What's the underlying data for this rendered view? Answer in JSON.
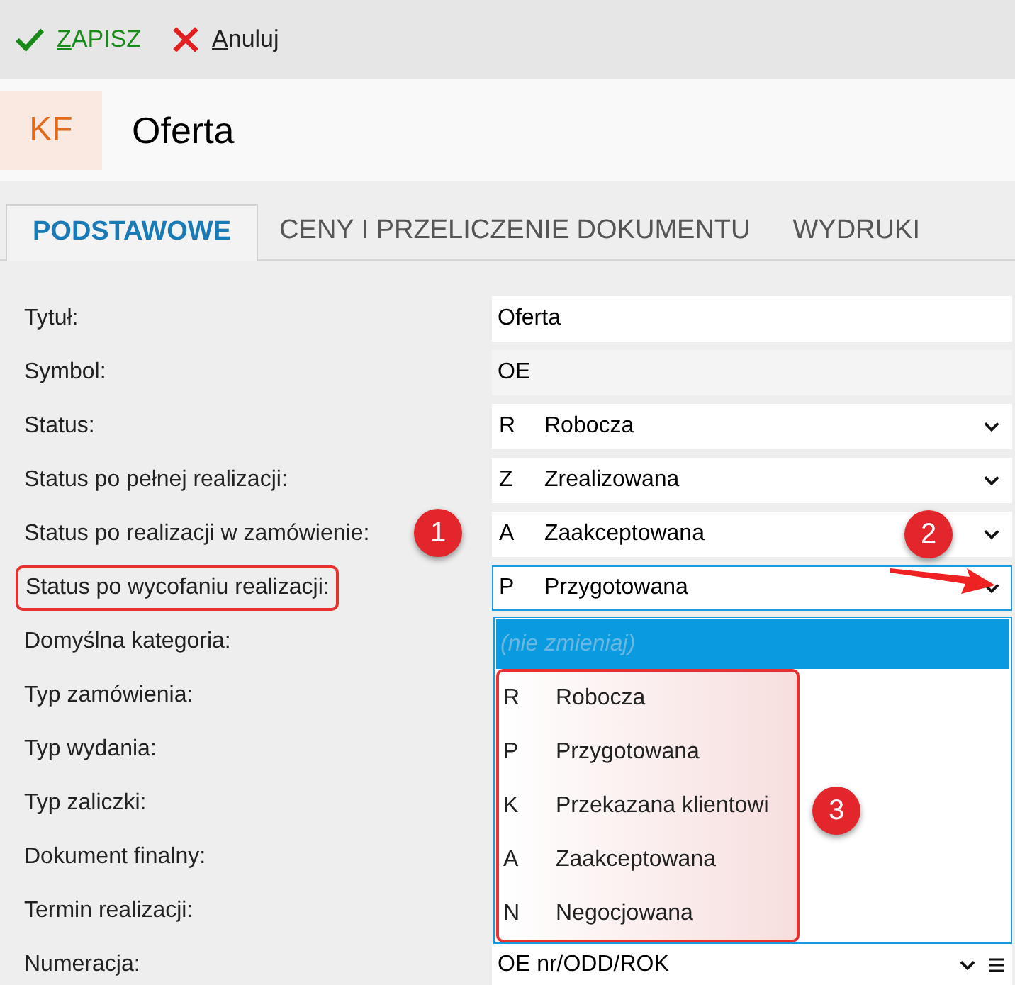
{
  "toolbar": [
    {
      "label": "ZAPISZ",
      "kind": "save",
      "mnemonic": true
    },
    {
      "label": "Anuluj",
      "kind": "cancel",
      "mnemonic": true
    }
  ],
  "header": {
    "badge": "KF",
    "title": "Oferta"
  },
  "tabs": [
    {
      "label": "PODSTAWOWE",
      "selected": true
    },
    {
      "label": "CENY I PRZELICZENIE DOKUMENTU",
      "selected": false
    },
    {
      "label": "WYDRUKI",
      "selected": false
    }
  ],
  "fields": [
    {
      "label": "Tytuł:",
      "kind": "text",
      "value": "Oferta"
    },
    {
      "label": "Symbol:",
      "kind": "readonly",
      "value": "OE"
    },
    {
      "label": "Status:",
      "kind": "select",
      "code": "R",
      "value": "Robocza"
    },
    {
      "label": "Status po pełnej realizacji:",
      "kind": "select",
      "code": "Z",
      "value": "Zrealizowana"
    },
    {
      "label": "Status po realizacji w zamówienie:",
      "kind": "select",
      "code": "A",
      "value": "Zaakceptowana"
    },
    {
      "label": "Status po wycofaniu realizacji:",
      "kind": "select",
      "code": "P",
      "value": "Przygotowana",
      "focused": true,
      "annotated": true
    },
    {
      "label": "Domyślna kategoria:",
      "kind": "hidden"
    },
    {
      "label": "Typ zamówienia:",
      "kind": "hidden"
    },
    {
      "label": "Typ wydania:",
      "kind": "hidden"
    },
    {
      "label": "Typ zaliczki:",
      "kind": "hidden"
    },
    {
      "label": "Dokument finalny:",
      "kind": "hidden"
    },
    {
      "label": "Termin realizacji:",
      "kind": "hidden"
    },
    {
      "label": "Numeracja:",
      "kind": "numbering",
      "value": "OE nr/ODD/ROK"
    }
  ],
  "dropdown": {
    "items": [
      {
        "value": "(nie zmieniaj)",
        "selected": true
      },
      {
        "code": "R",
        "value": "Robocza",
        "selected": false
      },
      {
        "code": "P",
        "value": "Przygotowana",
        "selected": false
      },
      {
        "code": "K",
        "value": "Przekazana klientowi",
        "selected": false
      },
      {
        "code": "A",
        "value": "Zaakceptowana",
        "selected": false
      },
      {
        "code": "N",
        "value": "Negocjowana",
        "selected": false
      }
    ]
  },
  "annotations": [
    {
      "number": "1",
      "kind": "label"
    },
    {
      "number": "2",
      "kind": "arrow"
    },
    {
      "number": "3",
      "kind": "bracket"
    }
  ]
}
